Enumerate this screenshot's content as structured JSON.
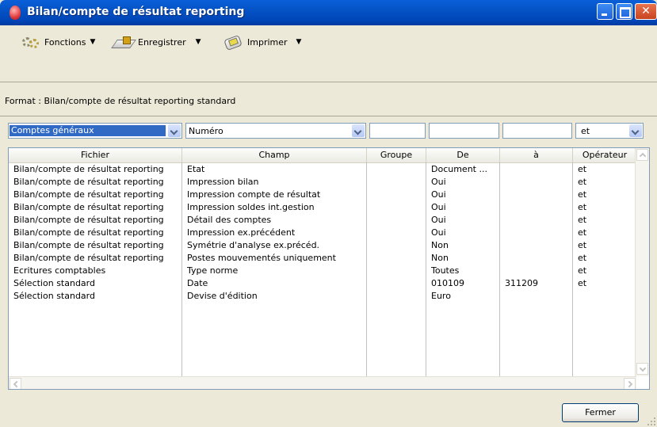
{
  "window": {
    "title": "Bilan/compte de résultat reporting",
    "title_bar_color": "#0453c6",
    "close_button_color": "#c94420"
  },
  "toolbar": {
    "functions_label": "Fonctions",
    "functions_icon": "gears-icon",
    "save_label": "Enregistrer",
    "save_icon": "save-icon",
    "print_label": "Imprimer",
    "print_icon": "printer-icon"
  },
  "format_text": "Format : Bilan/compte de résultat reporting standard",
  "filters": {
    "file_select": "Comptes généraux",
    "field_select": "Numéro",
    "groupe": "",
    "de": "",
    "a": "",
    "operator_select": "et",
    "selection_color": "#316ac5"
  },
  "table": {
    "headers": {
      "fichier": "Fichier",
      "champ": "Champ",
      "groupe": "Groupe",
      "de": "De",
      "a": "à",
      "operateur": "Opérateur"
    },
    "rows": [
      {
        "fichier": "Bilan/compte de résultat reporting",
        "champ": "Etat",
        "groupe": "",
        "de": "Document ...",
        "a": "",
        "operateur": "et"
      },
      {
        "fichier": "Bilan/compte de résultat reporting",
        "champ": "Impression bilan",
        "groupe": "",
        "de": "Oui",
        "a": "",
        "operateur": "et"
      },
      {
        "fichier": "Bilan/compte de résultat reporting",
        "champ": "Impression compte de résultat",
        "groupe": "",
        "de": "Oui",
        "a": "",
        "operateur": "et"
      },
      {
        "fichier": "Bilan/compte de résultat reporting",
        "champ": "Impression soldes int.gestion",
        "groupe": "",
        "de": "Oui",
        "a": "",
        "operateur": "et"
      },
      {
        "fichier": "Bilan/compte de résultat reporting",
        "champ": "Détail des comptes",
        "groupe": "",
        "de": "Oui",
        "a": "",
        "operateur": "et"
      },
      {
        "fichier": "Bilan/compte de résultat reporting",
        "champ": "Impression ex.précédent",
        "groupe": "",
        "de": "Oui",
        "a": "",
        "operateur": "et"
      },
      {
        "fichier": "Bilan/compte de résultat reporting",
        "champ": "Symétrie d'analyse ex.précéd.",
        "groupe": "",
        "de": "Non",
        "a": "",
        "operateur": "et"
      },
      {
        "fichier": "Bilan/compte de résultat reporting",
        "champ": "Postes mouvementés uniquement",
        "groupe": "",
        "de": "Non",
        "a": "",
        "operateur": "et"
      },
      {
        "fichier": "Ecritures comptables",
        "champ": "Type norme",
        "groupe": "",
        "de": "Toutes",
        "a": "",
        "operateur": "et"
      },
      {
        "fichier": "Sélection standard",
        "champ": "Date",
        "groupe": "",
        "de": "010109",
        "a": "311209",
        "operateur": "et"
      },
      {
        "fichier": "Sélection standard",
        "champ": "Devise d'édition",
        "groupe": "",
        "de": "Euro",
        "a": "",
        "operateur": ""
      }
    ]
  },
  "footer": {
    "close_label": "Fermer"
  }
}
